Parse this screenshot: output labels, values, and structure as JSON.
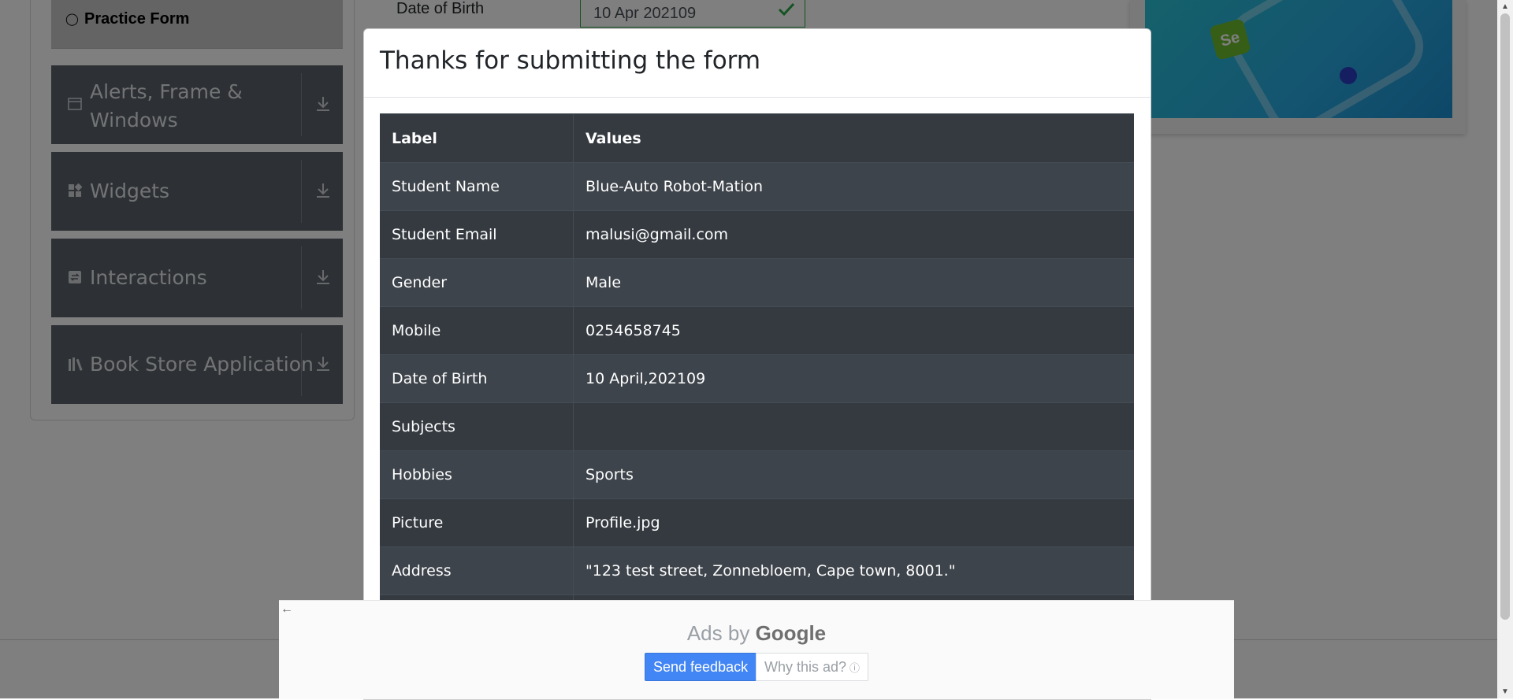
{
  "sidebar": {
    "practice_form_label": "Practice Form",
    "groups": [
      {
        "label_line1": "Alerts, Frame &",
        "label_line2": "Windows",
        "icon": "window-icon"
      },
      {
        "label": "Widgets",
        "icon": "widgets-icon"
      },
      {
        "label": "Interactions",
        "icon": "interactions-icon"
      },
      {
        "label": "Book Store Application",
        "icon": "books-icon"
      }
    ]
  },
  "form": {
    "dob_label": "Date of Birth",
    "dob_value": "10 Apr 202109"
  },
  "modal": {
    "title": "Thanks for submitting the form",
    "table": {
      "headers": [
        "Label",
        "Values"
      ],
      "rows": [
        {
          "label": "Student Name",
          "value": "Blue-Auto Robot-Mation"
        },
        {
          "label": "Student Email",
          "value": "malusi@gmail.com"
        },
        {
          "label": "Gender",
          "value": "Male"
        },
        {
          "label": "Mobile",
          "value": "0254658745"
        },
        {
          "label": "Date of Birth",
          "value": "10 April,202109"
        },
        {
          "label": "Subjects",
          "value": ""
        },
        {
          "label": "Hobbies",
          "value": "Sports"
        },
        {
          "label": "Picture",
          "value": "Profile.jpg"
        },
        {
          "label": "Address",
          "value": "\"123 test street, Zonnebloem, Cape town, 8001.\""
        }
      ]
    }
  },
  "ad": {
    "ads_by": "Ads by",
    "google": "Google",
    "send_feedback": "Send feedback",
    "why_this_ad": "Why this ad?"
  },
  "colors": {
    "sidebar_group_bg": "#5a6168",
    "table_dark": "#343a40",
    "valid_green": "#28a745",
    "ad_button_blue": "#4285f4"
  }
}
